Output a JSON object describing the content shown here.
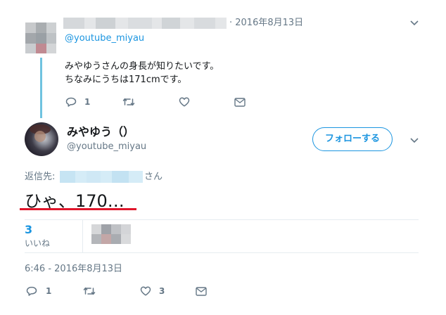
{
  "reply_tweet": {
    "timestamp": "2016年8月13日",
    "mention": "@youtube_miyau",
    "body_line1": "みやゆうさんの身長が知りたいです。",
    "body_line2": "ちなみにうちは171cmです。",
    "actions": {
      "reply_count": "1"
    }
  },
  "main_tweet": {
    "display_name": "みやゆう（）",
    "handle": "@youtube_miyau",
    "follow_label": "フォローする",
    "reply_to_prefix": "返信先:",
    "reply_to_suffix": "さん",
    "text": "ひゃ、170…",
    "likes_count": "3",
    "likes_label": "いいね",
    "timestamp": "6:46 - 2016年8月13日",
    "actions": {
      "reply_count": "1",
      "like_count": "3"
    }
  },
  "colors": {
    "accent": "#1b95e0",
    "thread_line": "#6fc3e0",
    "annotation_underline": "#e0162b",
    "muted": "#657786"
  }
}
